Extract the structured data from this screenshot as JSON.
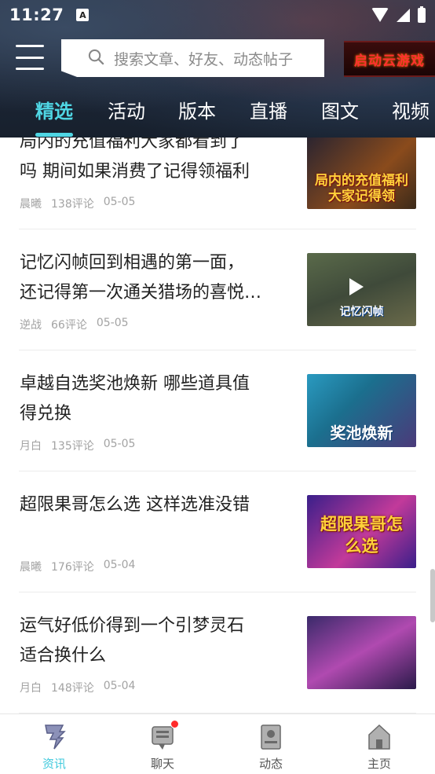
{
  "status_bar": {
    "time": "11:27",
    "notif_icon": "A"
  },
  "header": {
    "search_placeholder": "搜索文章、好友、动态帖子",
    "cloud_game_label": "启动云游戏"
  },
  "tabs": [
    {
      "label": "精选",
      "active": true
    },
    {
      "label": "活动",
      "active": false
    },
    {
      "label": "版本",
      "active": false
    },
    {
      "label": "直播",
      "active": false
    },
    {
      "label": "图文",
      "active": false
    },
    {
      "label": "视频",
      "active": false
    }
  ],
  "articles": [
    {
      "title_line1": "局内的充值福利大家都看到了",
      "title_line2": "吗 期间如果消费了记得领福利",
      "author": "晨曦",
      "comments": "138评论",
      "date": "05-05",
      "thumb_text": "局内的充值福利大家记得领",
      "thumb_colors": [
        "#3b2a1a",
        "#8a4b1c"
      ]
    },
    {
      "title_line1": "记忆闪帧回到相遇的第一面，",
      "title_line2": "还记得第一次通关猎场的喜悦…",
      "author": "逆战",
      "comments": "66评论",
      "date": "05-05",
      "thumb_text": "记忆闪帧",
      "thumb_colors": [
        "#3f4a3a",
        "#6a6a4a"
      ]
    },
    {
      "title_line1": "卓越自选奖池焕新 哪些道具值",
      "title_line2": "得兑换",
      "author": "月白",
      "comments": "135评论",
      "date": "05-05",
      "thumb_text": "奖池焕新",
      "thumb_colors": [
        "#1b6f8e",
        "#4b3a7a"
      ]
    },
    {
      "title_line1": "超限果哥怎么选 这样选准没错",
      "title_line2": "",
      "author": "晨曦",
      "comments": "176评论",
      "date": "05-04",
      "thumb_text": "超限果哥怎么选",
      "thumb_colors": [
        "#3a1f8a",
        "#c23a9a"
      ]
    },
    {
      "title_line1": "运气好低价得到一个引梦灵石",
      "title_line2": "适合换什么",
      "author": "月白",
      "comments": "148评论",
      "date": "05-04",
      "thumb_text": "",
      "thumb_colors": [
        "#3a2a6a",
        "#b04ab0"
      ]
    }
  ],
  "bottom_nav": [
    {
      "label": "资讯",
      "icon": "news-icon",
      "active": true,
      "badge": false
    },
    {
      "label": "聊天",
      "icon": "chat-icon",
      "active": false,
      "badge": true
    },
    {
      "label": "动态",
      "icon": "feed-icon",
      "active": false,
      "badge": false
    },
    {
      "label": "主页",
      "icon": "home-icon",
      "active": false,
      "badge": false
    }
  ],
  "colors": {
    "accent": "#4fd6e4",
    "badge": "#ff2a2a",
    "meta_text": "#a3a3a3"
  }
}
